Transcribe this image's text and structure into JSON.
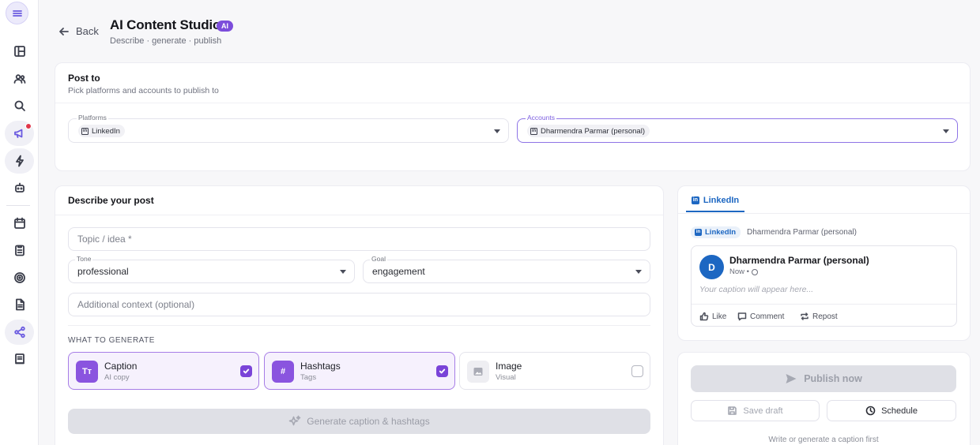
{
  "header": {
    "back_label": "Back",
    "title": "AI Content Studio",
    "badge": "AI",
    "subtitle": "Describe · generate · publish"
  },
  "post_to": {
    "title": "Post to",
    "subtitle": "Pick platforms and accounts to publish to",
    "platforms_label": "Platforms",
    "platform_value": "LinkedIn",
    "accounts_label": "Accounts",
    "account_value": "Dharmendra Parmar (personal)"
  },
  "describe": {
    "title": "Describe your post",
    "topic_placeholder": "Topic / idea *",
    "tone_label": "Tone",
    "tone_value": "professional",
    "goal_label": "Goal",
    "goal_value": "engagement",
    "context_placeholder": "Additional context (optional)",
    "what_to_generate": "WHAT TO GENERATE",
    "options": [
      {
        "title": "Caption",
        "subtitle": "AI copy",
        "icon": "Tт",
        "checked": true
      },
      {
        "title": "Hashtags",
        "subtitle": "Tags",
        "icon": "#",
        "checked": true
      },
      {
        "title": "Image",
        "subtitle": "Visual",
        "icon": "image-icon",
        "checked": false
      }
    ],
    "generate_label": "Generate caption & hashtags"
  },
  "preview": {
    "tab": "LinkedIn",
    "chip_platform": "LinkedIn",
    "chip_account": "Dharmendra Parmar (personal)",
    "avatar_initial": "D",
    "author": "Dharmendra Parmar (personal)",
    "time": "Now •",
    "caption_placeholder": "Your caption will appear here...",
    "actions": [
      "Like",
      "Comment",
      "Repost"
    ]
  },
  "publish": {
    "publish_label": "Publish now",
    "save_label": "Save draft",
    "schedule_label": "Schedule",
    "hint": "Write or generate a caption first"
  },
  "colors": {
    "accent": "#7c4ddb",
    "linkedin": "#1d67c2",
    "notification": "#e0364a"
  }
}
